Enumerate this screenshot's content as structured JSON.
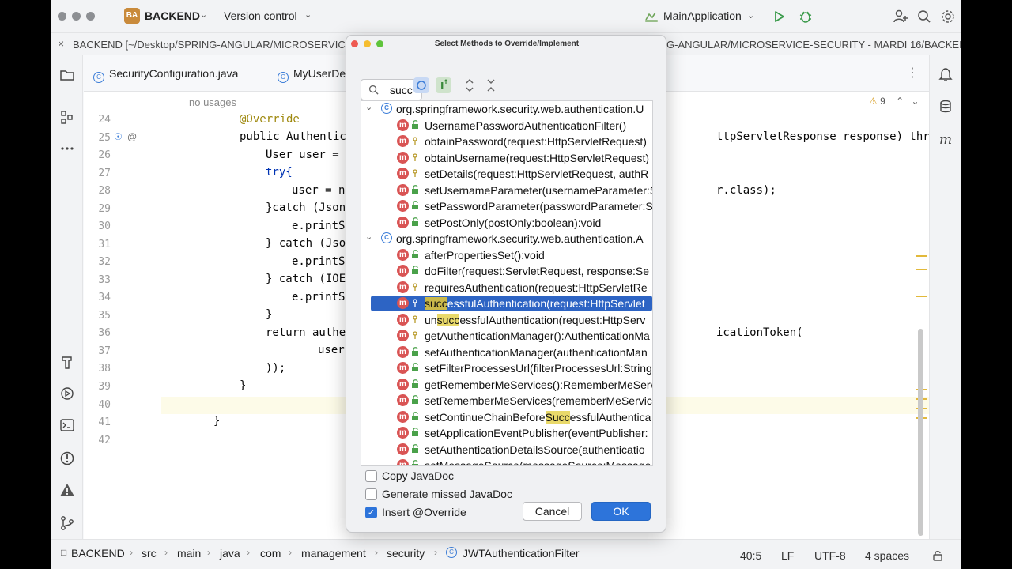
{
  "titlebar": {
    "project_badge": "BA",
    "project_name": "BACKEND",
    "version_control": "Version control",
    "run_config": "MainApplication"
  },
  "pathbar": {
    "left_path": "BACKEND [~/Desktop/SPRING-ANGULAR/MICROSERVICE",
    "right_path": "G-ANGULAR/MICROSERVICE-SECURITY - MARDI 16/BACKEI"
  },
  "tabs": [
    {
      "label": "SecurityConfiguration.java"
    },
    {
      "label": "MyUserDe"
    }
  ],
  "editor": {
    "usage_hint": "no usages",
    "warning_count": "9",
    "line_numbers": [
      "24",
      "25",
      "26",
      "27",
      "28",
      "29",
      "30",
      "31",
      "32",
      "33",
      "34",
      "35",
      "36",
      "37",
      "38",
      "39",
      "40",
      "41",
      "42"
    ],
    "lines": [
      "@Override",
      "public Authentication at",
      "User user = null;",
      "try{",
      "user = new Objec",
      "}catch (JsonParseExc",
      "e.printStackTrac",
      "} catch (JsonMapping",
      "e.printStackTrac",
      "} catch (IOException",
      "e.printStackTrac",
      "}",
      "return authenticatio",
      "user.getUser",
      "));",
      "}",
      "",
      "}",
      ""
    ],
    "right_fragments": {
      "line25": "ttpServletResponse response) throws Authe",
      "line28": "r.class);",
      "line36": "icationToken("
    }
  },
  "dialog": {
    "title": "Select Methods to Override/Implement",
    "search_value": "succ",
    "groups": [
      {
        "package": "org.springframework.security.web.authentication.U"
      },
      {
        "package": "org.springframework.security.web.authentication.A"
      }
    ],
    "methods": [
      {
        "pre": "",
        "hl": "",
        "post": "UsernamePasswordAuthenticationFilter()"
      },
      {
        "pre": "",
        "hl": "",
        "post": "obtainPassword(request:HttpServletRequest)"
      },
      {
        "pre": "",
        "hl": "",
        "post": "obtainUsername(request:HttpServletRequest)"
      },
      {
        "pre": "",
        "hl": "",
        "post": "setDetails(request:HttpServletRequest, authR"
      },
      {
        "pre": "",
        "hl": "",
        "post": "setUsernameParameter(usernameParameter:S"
      },
      {
        "pre": "",
        "hl": "",
        "post": "setPasswordParameter(passwordParameter:S"
      },
      {
        "pre": "",
        "hl": "",
        "post": "setPostOnly(postOnly:boolean):void"
      },
      {
        "pre": "",
        "hl": "",
        "post": "afterPropertiesSet():void"
      },
      {
        "pre": "",
        "hl": "",
        "post": "doFilter(request:ServletRequest, response:Se"
      },
      {
        "pre": "",
        "hl": "",
        "post": "requiresAuthentication(request:HttpServletRe"
      },
      {
        "pre": "",
        "hl": "succ",
        "post": "essfulAuthentication(request:HttpServlet"
      },
      {
        "pre": "un",
        "hl": "succ",
        "post": "essfulAuthentication(request:HttpServ"
      },
      {
        "pre": "",
        "hl": "",
        "post": "getAuthenticationManager():AuthenticationMa"
      },
      {
        "pre": "",
        "hl": "",
        "post": "setAuthenticationManager(authenticationMan"
      },
      {
        "pre": "",
        "hl": "",
        "post": "setFilterProcessesUrl(filterProcessesUrl:String"
      },
      {
        "pre": "",
        "hl": "",
        "post": "getRememberMeServices():RememberMeServ"
      },
      {
        "pre": "",
        "hl": "",
        "post": "setRememberMeServices(rememberMeServic"
      },
      {
        "pre": "setContinueChainBefore",
        "hl": "Succ",
        "post": "essfulAuthentica"
      },
      {
        "pre": "",
        "hl": "",
        "post": "setApplicationEventPublisher(eventPublisher:"
      },
      {
        "pre": "",
        "hl": "",
        "post": "setAuthenticationDetailsSource(authenticatio"
      },
      {
        "pre": "",
        "hl": "",
        "post": "setMessageSource(messageSource:Message"
      }
    ],
    "options": {
      "copy_javadoc": "Copy JavaDoc",
      "generate_javadoc": "Generate missed JavaDoc",
      "insert_override": "Insert @Override"
    },
    "cancel_label": "Cancel",
    "ok_label": "OK"
  },
  "statusbar": {
    "crumbs": [
      "BACKEND",
      "src",
      "main",
      "java",
      "com",
      "management",
      "security",
      "JWTAuthenticationFilter"
    ],
    "position": "40:5",
    "line_sep": "LF",
    "encoding": "UTF-8",
    "indent": "4 spaces"
  }
}
